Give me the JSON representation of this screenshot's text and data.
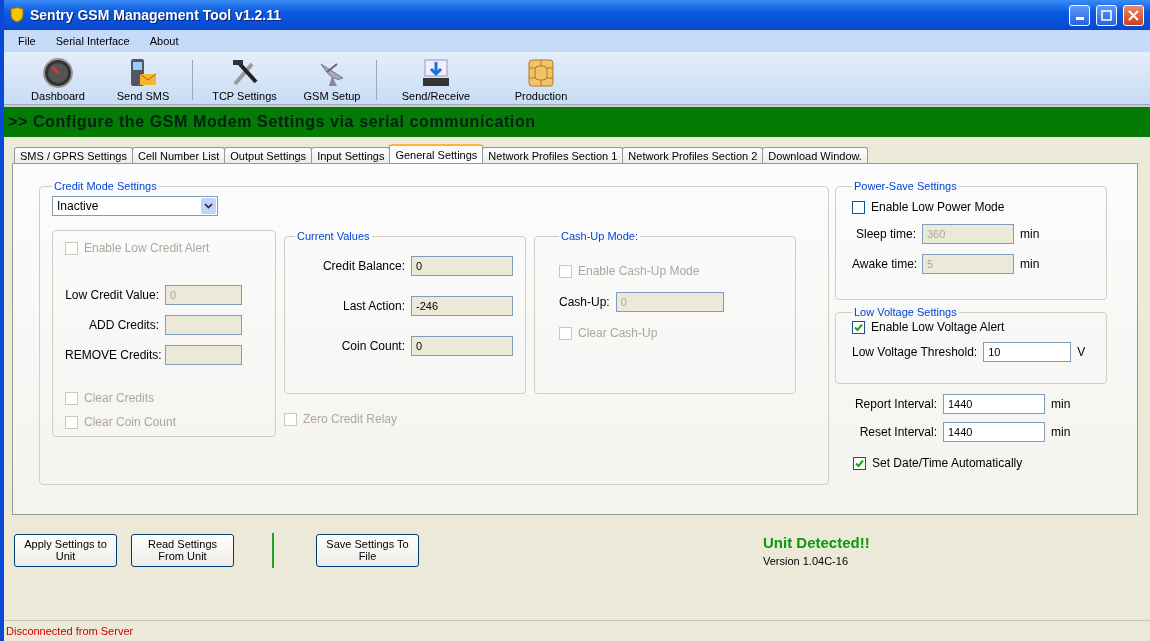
{
  "window": {
    "title": "Sentry GSM Management Tool v1.2.11"
  },
  "menu": [
    "File",
    "Serial Interface",
    "About"
  ],
  "toolbar": [
    {
      "label": "Dashboard"
    },
    {
      "label": "Send SMS"
    },
    {
      "label": "TCP Settings"
    },
    {
      "label": "GSM Setup"
    },
    {
      "label": "Send/Receive"
    },
    {
      "label": "Production"
    }
  ],
  "banner": ">> Configure the GSM Modem Settings via serial communication",
  "tabs": [
    {
      "label": "SMS / GPRS Settings",
      "selected": false
    },
    {
      "label": "Cell Number List",
      "selected": false
    },
    {
      "label": "Output Settings",
      "selected": false
    },
    {
      "label": "Input Settings",
      "selected": false
    },
    {
      "label": "General Settings",
      "selected": true
    },
    {
      "label": "Network Profiles Section 1",
      "selected": false
    },
    {
      "label": "Network Profiles Section 2",
      "selected": false
    },
    {
      "label": "Download Window.",
      "selected": false
    }
  ],
  "credit_mode": {
    "title": "Credit Mode Settings",
    "mode": "Inactive",
    "alert": {
      "enable": {
        "label": "Enable Low Credit Alert",
        "checked": false,
        "disabled": true
      },
      "fields": [
        {
          "label": "Low Credit Value:",
          "value": "0",
          "disabled": true
        },
        {
          "label": "ADD Credits:",
          "disabled": true
        },
        {
          "label": "REMOVE Credits:",
          "disabled": true
        }
      ],
      "checks": [
        {
          "label": "Clear Credits",
          "checked": false,
          "disabled": true
        },
        {
          "label": "Clear Coin Count",
          "checked": false,
          "disabled": true
        }
      ]
    },
    "current_values": {
      "title": "Current Values",
      "fields": [
        {
          "label": "Credit Balance:",
          "value": "0",
          "disabled": false
        },
        {
          "label": "Last Action:",
          "value": "-246",
          "disabled": false
        },
        {
          "label": "Coin Count:",
          "value": "0",
          "disabled": false
        }
      ]
    },
    "zero_credit_relay": {
      "label": "Zero Credit Relay",
      "checked": false,
      "disabled": true
    },
    "cash_up": {
      "title": "Cash-Up Mode:",
      "enable": {
        "label": "Enable Cash-Up Mode",
        "checked": false,
        "disabled": true
      },
      "field": {
        "label": "Cash-Up:",
        "value": "0",
        "disabled": true
      },
      "clear": {
        "label": "Clear Cash-Up",
        "checked": false,
        "disabled": true
      }
    }
  },
  "power_save": {
    "title": "Power-Save Settings",
    "enable": {
      "label": "Enable Low Power Mode",
      "checked": false,
      "disabled": false
    },
    "fields": [
      {
        "label": "Sleep time:",
        "value": "360",
        "unit": "min",
        "disabled": true
      },
      {
        "label": "Awake time:",
        "value": "5",
        "unit": "min",
        "disabled": true
      }
    ]
  },
  "low_voltage": {
    "title": "Low Voltage Settings",
    "enable": {
      "label": "Enable Low Voltage Alert",
      "checked": true,
      "disabled": false
    },
    "field": {
      "label": "Low Voltage Threshold:",
      "value": "10",
      "unit": "V",
      "disabled": false
    }
  },
  "intervals": [
    {
      "label": "Report Interval:",
      "value": "1440",
      "unit": "min",
      "disabled": false
    },
    {
      "label": "Reset Interval:",
      "value": "1440",
      "unit": "min",
      "disabled": false
    }
  ],
  "auto_datetime": {
    "label": "Set Date/Time Automatically",
    "checked": true,
    "disabled": false
  },
  "buttons": [
    {
      "label": "Apply Settings to Unit"
    },
    {
      "label": "Read Settings From Unit"
    },
    {
      "label": "Save Settings To File"
    }
  ],
  "unit_status": {
    "title": "Unit Detected!!",
    "version": "Version 1.04C-16"
  },
  "status_bar": "Disconnected from Server"
}
